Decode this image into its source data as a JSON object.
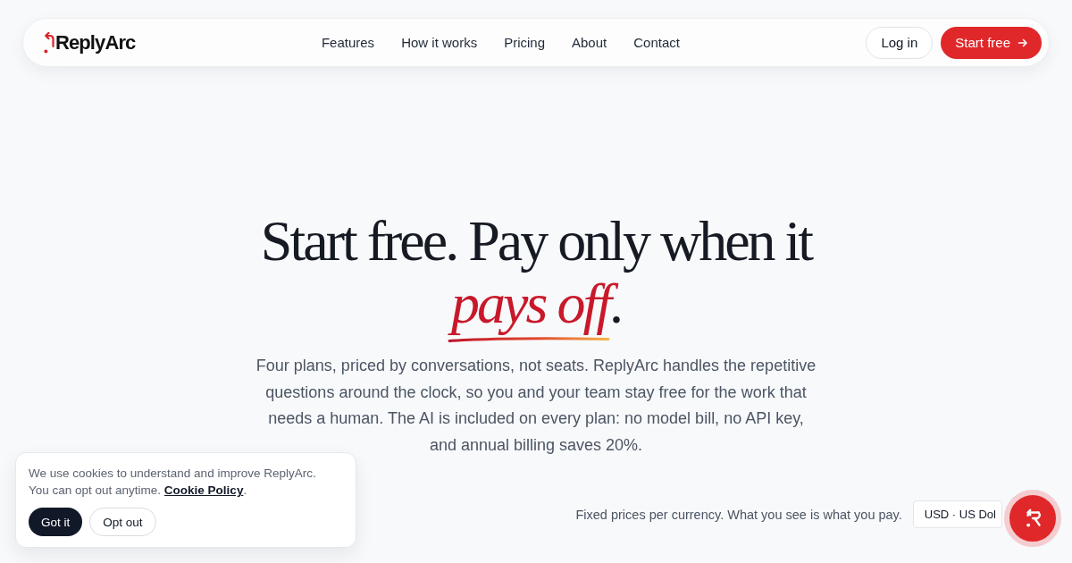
{
  "nav": {
    "brand": "ReplyArc",
    "links": [
      "Features",
      "How it works",
      "Pricing",
      "About",
      "Contact"
    ],
    "login": "Log in",
    "cta": "Start free"
  },
  "hero": {
    "headline": "Start free. Pay only when it *pays off*.",
    "description": "Four plans, priced by conversations, not seats. ReplyArc handles the repetitive questions around the clock, so you and your team stay free for the work that needs a human. The AI is included on every plan: no model bill, no API key, and annual billing saves 20%."
  },
  "currency": {
    "note": "Fixed prices per currency. What you see is what you pay.",
    "selected_value": "USD · US Dol"
  },
  "cookie_banner": {
    "text": "We use cookies to understand and improve ReplyArc. You can opt out anytime.",
    "link": "Cookie Policy",
    "suffix": ".",
    "buttons": [
      {
        "label": "Got it",
        "kind": "primary"
      },
      {
        "label": "Opt out",
        "kind": "secondary"
      }
    ]
  }
}
